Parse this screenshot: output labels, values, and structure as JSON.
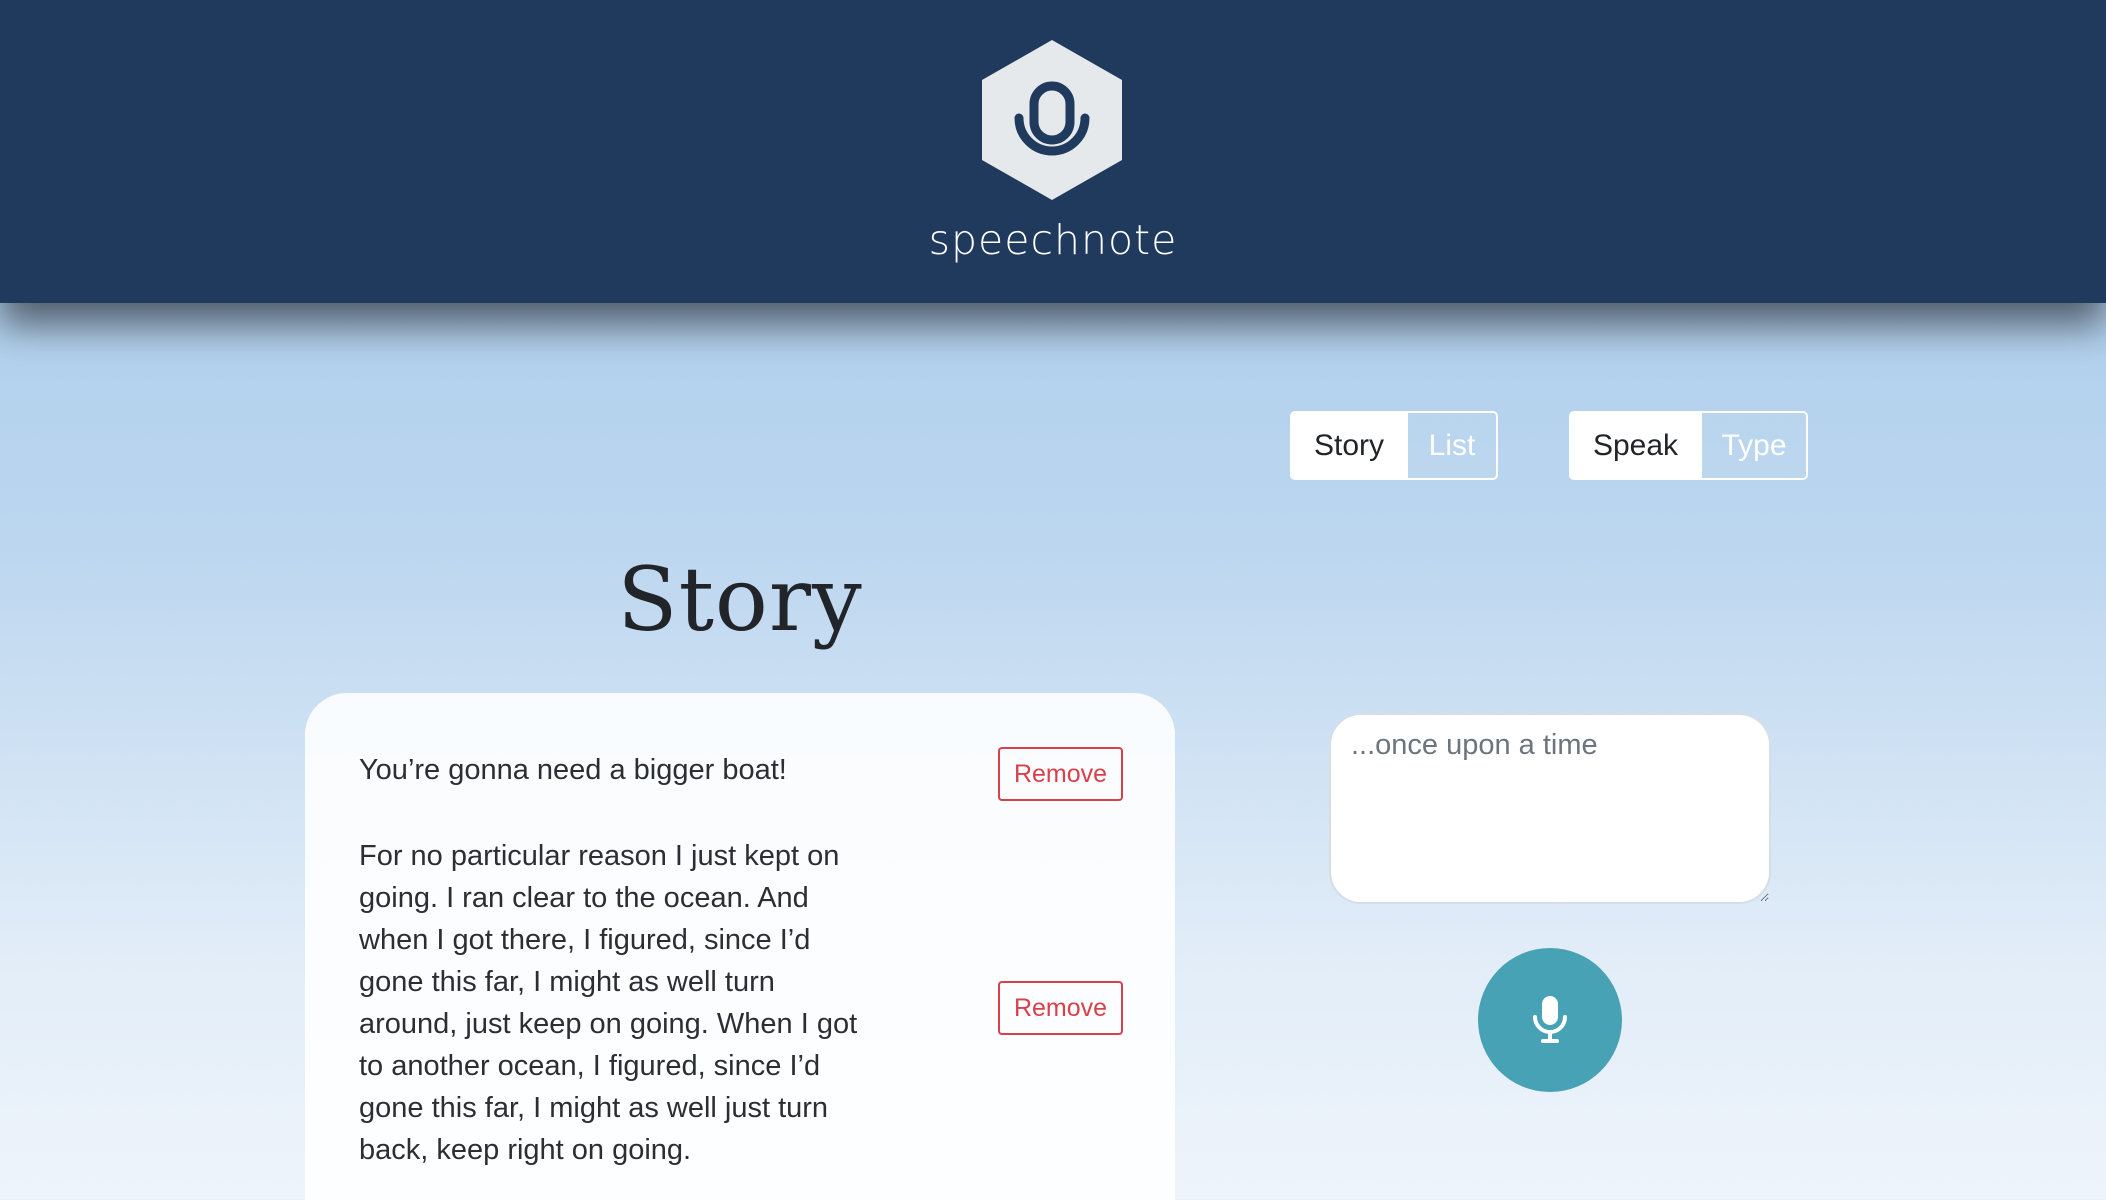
{
  "header": {
    "brand_name": "speechnote",
    "logo_icon": "microphone-hexagon-icon",
    "background_color": "#1f3a5c"
  },
  "controls": {
    "mode_toggle": {
      "options": [
        "Story",
        "List"
      ],
      "selected": "Story"
    },
    "input_toggle": {
      "options": [
        "Speak",
        "Type"
      ],
      "selected": "Speak"
    }
  },
  "main": {
    "title": "Story",
    "items": [
      {
        "text": "You’re gonna need a bigger boat!",
        "remove_label": "Remove"
      },
      {
        "text": "For no particular reason I just kept on going. I ran clear to the ocean. And when I got there, I figured, since I’d gone this far, I might as well turn around, just keep on going. When I got to another ocean, I figured, since I’d gone this far, I might as well just turn back, keep right on going.",
        "remove_label": "Remove"
      }
    ]
  },
  "composer": {
    "placeholder": "...once upon a time",
    "value": "",
    "mic_icon": "microphone-icon",
    "accent_color": "#48a2b6"
  }
}
